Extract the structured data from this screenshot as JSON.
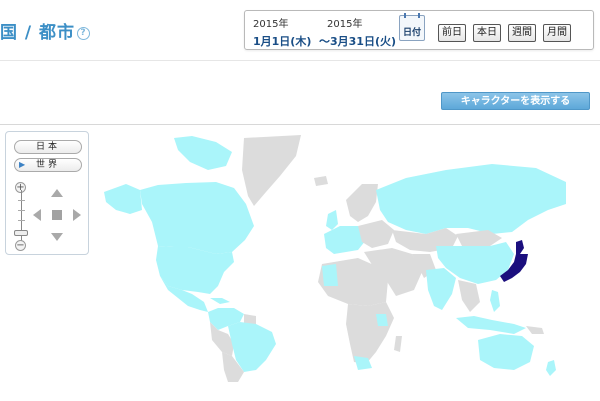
{
  "header": {
    "title": "国 / 都市",
    "help_icon": "question-circle-icon"
  },
  "date_range": {
    "start_year": "2015年",
    "start_date": "1月1日(木)",
    "end_year": "2015年",
    "end_date": "～3月31日(火)",
    "calendar_label": "日付",
    "buttons": [
      "前日",
      "本日",
      "週間",
      "月間"
    ]
  },
  "actions": {
    "character_label": "キャラクターを表示する"
  },
  "map_controls": {
    "region_buttons": [
      "日本",
      "世界"
    ],
    "selected_region": "世界",
    "zoom_in": "+",
    "zoom_out": "−"
  },
  "map": {
    "colors": {
      "no_data": "#dcdcdc",
      "low": "#aaf5fa",
      "highest": "#1b0f7e",
      "background": "#ffffff"
    },
    "highlighted_country": "japan"
  }
}
